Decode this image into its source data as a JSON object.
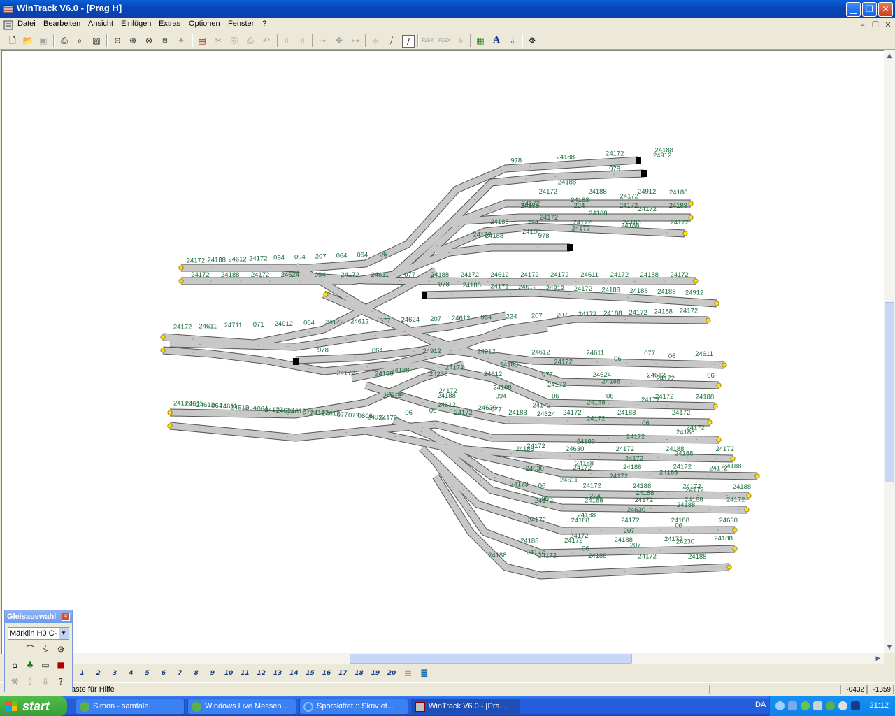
{
  "window": {
    "title": "WinTrack  V6.0 - [Prag H]"
  },
  "menu": {
    "items": [
      "Datei",
      "Bearbeiten",
      "Ansicht",
      "Einfügen",
      "Extras",
      "Optionen",
      "Fenster",
      "?"
    ]
  },
  "toolbar": {
    "icons": [
      "new-icon",
      "open-icon",
      "save-icon",
      "print-icon",
      "print-preview-icon",
      "image-icon",
      "zoom-out-icon",
      "zoom-in-icon",
      "zoom-window-icon",
      "zoom-all-icon",
      "zoom-extents-icon",
      "parts-list-icon",
      "cut-icon",
      "copy-icon",
      "paste-icon",
      "undo-icon",
      "flip-icon",
      "mirror-icon",
      "connect-icon",
      "rotate-icon",
      "disconnect-icon",
      "turnout-icon",
      "curve-icon",
      "flex-icon",
      "flex-a-icon",
      "flex-b-icon",
      "measure-icon",
      "landscape-icon",
      "text-icon",
      "signal-icon",
      "help-icon"
    ]
  },
  "track_labels": {
    "row1": [
      "24172",
      "24188",
      "24612",
      "24172",
      "094",
      "094",
      "207",
      "064",
      "064",
      "06"
    ],
    "row2": [
      "24172",
      "24188",
      "24172",
      "24624",
      "094",
      "24172",
      "24611",
      "077",
      "24188",
      "24172",
      "24612",
      "24172",
      "24172",
      "24611",
      "24172",
      "24188",
      "24172"
    ],
    "upper_right": [
      "978",
      "24188",
      "24172",
      "24188",
      "24912",
      "978",
      "24188",
      "24172",
      "24188",
      "24912",
      "24188",
      "24172",
      "24188",
      "24172",
      "24188",
      "224",
      "24172",
      "24188",
      "24172",
      "24188",
      "24172",
      "24188",
      "224",
      "24172",
      "24188",
      "24172",
      "24188",
      "24172",
      "24188",
      "24172",
      "24188",
      "978"
    ],
    "row3": [
      "978",
      "24188",
      "24172",
      "24612",
      "24912",
      "24172",
      "24188",
      "24188",
      "24188",
      "24912"
    ],
    "middle": [
      "24172",
      "24611",
      "24711",
      "071",
      "24912",
      "064",
      "24172",
      "24612",
      "077",
      "24624",
      "207",
      "24612",
      "064",
      "224",
      "207",
      "207",
      "24172",
      "24188",
      "24172",
      "24188",
      "24172"
    ],
    "mid2": [
      "978",
      "064",
      "24912",
      "24912",
      "24612",
      "24611",
      "077",
      "24611",
      "06",
      "06",
      "24172",
      "24188",
      "24172",
      "24188",
      "24172",
      "24188",
      "24230",
      "24612",
      "077",
      "24624",
      "24612",
      "06",
      "24172",
      "24188",
      "24172",
      "24188",
      "24172",
      "24188",
      "24612",
      "24188",
      "094",
      "06",
      "06",
      "24172",
      "24188",
      "24172",
      "24188",
      "24172",
      "24630",
      "06",
      "06",
      "24172",
      "24188",
      "24172",
      "24188",
      "24172"
    ],
    "lower_left": [
      "24172",
      "24611",
      "24612",
      "064",
      "24611",
      "24912",
      "094",
      "064",
      "24172",
      "24612",
      "24612",
      "077",
      "24172",
      "24612",
      "077",
      "077",
      "0606",
      "24912",
      "24172"
    ],
    "lower_right": [
      "24612",
      "077",
      "24624",
      "24172",
      "06",
      "24172",
      "24188",
      "24172",
      "24188",
      "24172",
      "24188",
      "24630",
      "24172",
      "24188",
      "24172",
      "24188",
      "24172",
      "24188",
      "24630",
      "24172",
      "24188",
      "24172",
      "24188",
      "24172",
      "24188",
      "24172",
      "24611",
      "24173",
      "06",
      "24172",
      "24188",
      "24172",
      "24188",
      "24172",
      "24188",
      "224",
      "06",
      "24172",
      "24188",
      "24172",
      "24188",
      "24172",
      "24188",
      "24630",
      "24188",
      "24172",
      "24188",
      "24172",
      "24188",
      "24630",
      "06",
      "207",
      "24172",
      "24188",
      "24172",
      "24188",
      "24172",
      "24188",
      "24230",
      "207",
      "06",
      "24172",
      "24188",
      "24172",
      "24188",
      "24172",
      "24188"
    ]
  },
  "scrollbars": {
    "vertical_position": 0.42,
    "horizontal_position": 0.34
  },
  "layers": {
    "icons": [
      "layer-1",
      "layer-2",
      "layer-3",
      "layer-4",
      "layer-5",
      "layer-6",
      "layer-7",
      "layer-8",
      "layer-9",
      "layer-10",
      "layer-11",
      "layer-12",
      "layer-13",
      "layer-14",
      "layer-15",
      "layer-16",
      "layer-17",
      "layer-18",
      "layer-19",
      "layer-20",
      "layer-all",
      "layer-select"
    ]
  },
  "status": {
    "text": "Drücken Sie F1, Taste für Hilfe",
    "visible_text": "aste für Hilfe",
    "x": "-0432",
    "y": "-1359"
  },
  "palette": {
    "title": "Gleisauswahl",
    "selected": "Märklin H0 C-"
  },
  "taskbar": {
    "start": "start",
    "tasks": [
      "Simon - samtale",
      "Windows Live Messen...",
      "Sporskiftet :: Skriv et...",
      "WinTrack  V6.0 - [Pra..."
    ],
    "language": "DA",
    "clock": "21:12"
  }
}
